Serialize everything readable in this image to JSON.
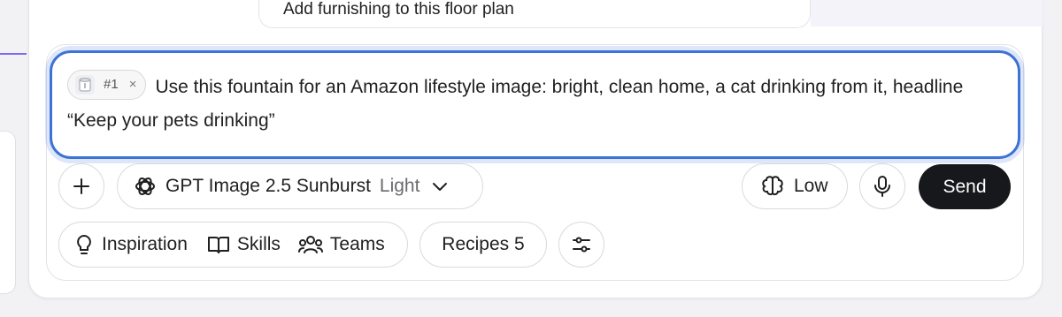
{
  "suggestion": {
    "text": "Add furnishing to this floor plan"
  },
  "composer": {
    "attachment": {
      "label": "#1",
      "remove": "×"
    },
    "input_text": "Use this fountain for an Amazon lifestyle image: bright, clean home, a cat drinking from it, headline “Keep your pets drinking”",
    "model": {
      "name": "GPT Image 2.5 Sunburst",
      "variant": "Light"
    },
    "effort": {
      "label": "Low"
    },
    "send_label": "Send",
    "toolbar": {
      "inspiration": "Inspiration",
      "skills": "Skills",
      "teams": "Teams",
      "recipes": "Recipes 5"
    }
  },
  "colors": {
    "focus_border": "#3d72d6",
    "send_bg": "#17181b",
    "accent": "#7c6cf0"
  },
  "icons": [
    "plus-icon",
    "openai-logo-icon",
    "chevron-down-icon",
    "brain-icon",
    "microphone-icon",
    "lightbulb-icon",
    "book-icon",
    "team-icon",
    "sliders-icon",
    "fountain-thumbnail"
  ]
}
